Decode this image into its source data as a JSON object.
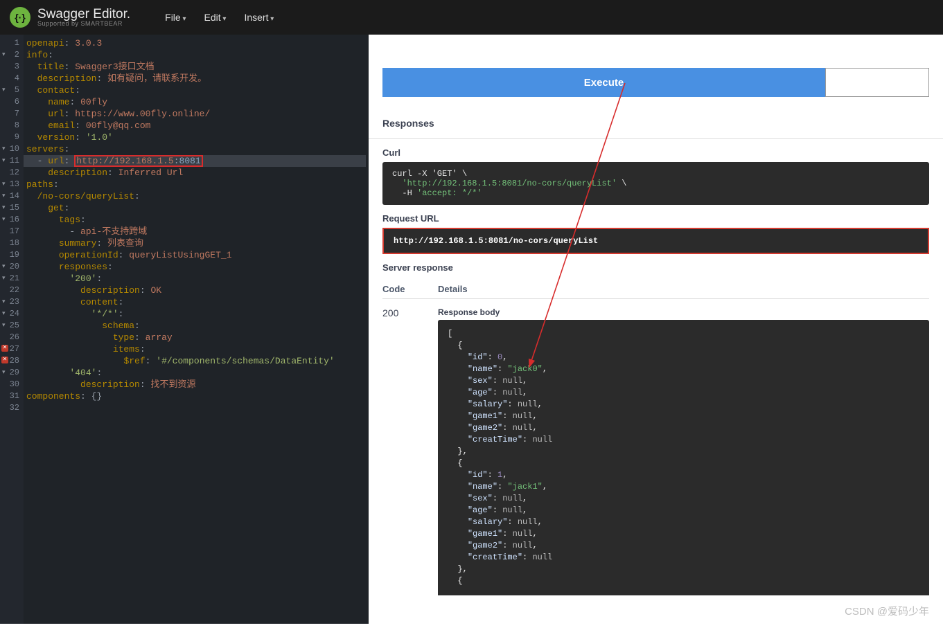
{
  "header": {
    "brand": "Swagger Editor.",
    "sub": "Supported by SMARTBEAR",
    "menu": [
      "File",
      "Edit",
      "Insert"
    ]
  },
  "editor": {
    "lines": [
      {
        "n": 1,
        "fold": false,
        "html": "<span class='tok-key'>openapi</span><span class='tok-punc'>:</span> <span class='tok-str'>3.0.3</span>"
      },
      {
        "n": 2,
        "fold": true,
        "html": "<span class='tok-key'>info</span><span class='tok-punc'>:</span>"
      },
      {
        "n": 3,
        "fold": false,
        "html": "  <span class='tok-key'>title</span><span class='tok-punc'>:</span> <span class='tok-str'>Swagger3接口文档</span>"
      },
      {
        "n": 4,
        "fold": false,
        "html": "  <span class='tok-key'>description</span><span class='tok-punc'>:</span> <span class='tok-str'>如有疑问，请联系开发。</span>"
      },
      {
        "n": 5,
        "fold": true,
        "html": "  <span class='tok-key'>contact</span><span class='tok-punc'>:</span>"
      },
      {
        "n": 6,
        "fold": false,
        "html": "    <span class='tok-key'>name</span><span class='tok-punc'>:</span> <span class='tok-str'>00fly</span>"
      },
      {
        "n": 7,
        "fold": false,
        "html": "    <span class='tok-key'>url</span><span class='tok-punc'>:</span> <span class='tok-str'>https://www.00fly.online/</span>"
      },
      {
        "n": 8,
        "fold": false,
        "html": "    <span class='tok-key'>email</span><span class='tok-punc'>:</span> <span class='tok-str'>00fly@qq.com</span>"
      },
      {
        "n": 9,
        "fold": false,
        "html": "  <span class='tok-key'>version</span><span class='tok-punc'>:</span> <span class='tok-strg'>'1.0'</span>"
      },
      {
        "n": 10,
        "fold": true,
        "html": "<span class='tok-key'>servers</span><span class='tok-punc'>:</span>"
      },
      {
        "n": 11,
        "fold": true,
        "hl": true,
        "html": "  <span class='tok-punc'>-</span> <span class='tok-key'>url</span><span class='tok-punc'>:</span> <span class='red-box'><span class='tok-str'>http://192.168.1.5</span><span class='tok-punc'>:</span><span class='tok-num'>8081</span></span>"
      },
      {
        "n": 12,
        "fold": false,
        "html": "    <span class='tok-key'>description</span><span class='tok-punc'>:</span> <span class='tok-str'>Inferred Url</span>"
      },
      {
        "n": 13,
        "fold": true,
        "html": "<span class='tok-key'>paths</span><span class='tok-punc'>:</span>"
      },
      {
        "n": 14,
        "fold": true,
        "html": "  <span class='tok-key'>/no-cors/queryList</span><span class='tok-punc'>:</span>"
      },
      {
        "n": 15,
        "fold": true,
        "html": "    <span class='tok-key'>get</span><span class='tok-punc'>:</span>"
      },
      {
        "n": 16,
        "fold": true,
        "html": "      <span class='tok-key'>tags</span><span class='tok-punc'>:</span>"
      },
      {
        "n": 17,
        "fold": false,
        "html": "        <span class='tok-punc'>-</span> <span class='tok-str'>api-不支持跨域</span>"
      },
      {
        "n": 18,
        "fold": false,
        "html": "      <span class='tok-key'>summary</span><span class='tok-punc'>:</span> <span class='tok-str'>列表查询</span>"
      },
      {
        "n": 19,
        "fold": false,
        "html": "      <span class='tok-key'>operationId</span><span class='tok-punc'>:</span> <span class='tok-str'>queryListUsingGET_1</span>"
      },
      {
        "n": 20,
        "fold": true,
        "html": "      <span class='tok-key'>responses</span><span class='tok-punc'>:</span>"
      },
      {
        "n": 21,
        "fold": true,
        "html": "        <span class='tok-strg'>'200'</span><span class='tok-punc'>:</span>"
      },
      {
        "n": 22,
        "fold": false,
        "html": "          <span class='tok-key'>description</span><span class='tok-punc'>:</span> <span class='tok-str'>OK</span>"
      },
      {
        "n": 23,
        "fold": true,
        "html": "          <span class='tok-key'>content</span><span class='tok-punc'>:</span>"
      },
      {
        "n": 24,
        "fold": true,
        "html": "            <span class='tok-strg'>'*/*'</span><span class='tok-punc'>:</span>"
      },
      {
        "n": 25,
        "fold": true,
        "html": "              <span class='tok-key'>schema</span><span class='tok-punc'>:</span>"
      },
      {
        "n": 26,
        "fold": false,
        "html": "                <span class='tok-key'>type</span><span class='tok-punc'>:</span> <span class='tok-str'>array</span>"
      },
      {
        "n": 27,
        "fold": true,
        "err": true,
        "html": "                <span class='tok-key'>items</span><span class='tok-punc'>:</span>"
      },
      {
        "n": 28,
        "fold": false,
        "err": true,
        "html": "                  <span class='tok-key'>$ref</span><span class='tok-punc'>:</span> <span class='tok-strg'>'#/components/schemas/DataEntity'</span>"
      },
      {
        "n": 29,
        "fold": true,
        "html": "        <span class='tok-strg'>'404'</span><span class='tok-punc'>:</span>"
      },
      {
        "n": 30,
        "fold": false,
        "html": "          <span class='tok-key'>description</span><span class='tok-punc'>:</span> <span class='tok-str'>找不到资源</span>"
      },
      {
        "n": 31,
        "fold": false,
        "html": "<span class='tok-key'>components</span><span class='tok-punc'>:</span> <span class='tok-punc'>{}</span>"
      },
      {
        "n": 32,
        "fold": false,
        "html": ""
      }
    ]
  },
  "preview": {
    "execute": "Execute",
    "responses_h": "Responses",
    "curl_h": "Curl",
    "curl_cmd_l1": "curl -X 'GET' \\",
    "curl_cmd_l2": "'http://192.168.1.5:8081/no-cors/queryList'",
    "curl_cmd_l2_tail": " \\",
    "curl_cmd_l3": "-H 'accept: */*'",
    "req_url_h": "Request URL",
    "req_url": "http://192.168.1.5:8081/no-cors/queryList",
    "server_resp_h": "Server response",
    "th_code": "Code",
    "th_details": "Details",
    "code200": "200",
    "resp_body_h": "Response body",
    "resp_body": "[\n  {\n    \"id\": 0,\n    \"name\": \"jack0\",\n    \"sex\": null,\n    \"age\": null,\n    \"salary\": null,\n    \"game1\": null,\n    \"game2\": null,\n    \"creatTime\": null\n  },\n  {\n    \"id\": 1,\n    \"name\": \"jack1\",\n    \"sex\": null,\n    \"age\": null,\n    \"salary\": null,\n    \"game1\": null,\n    \"game2\": null,\n    \"creatTime\": null\n  },\n  {"
  },
  "watermark": "CSDN @爱码少年"
}
